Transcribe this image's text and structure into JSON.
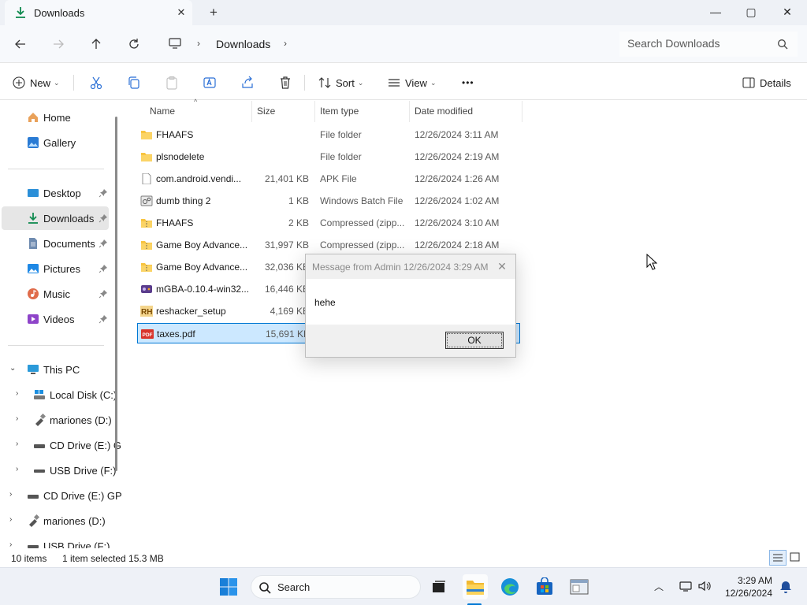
{
  "window": {
    "tab_title": "Downloads",
    "tab_close": "✕",
    "new_tab": "+",
    "minimize": "—",
    "maximize": "▢",
    "close": "✕"
  },
  "address": {
    "crumbs": [
      "Downloads"
    ],
    "search_placeholder": "Search Downloads"
  },
  "commands": {
    "new_label": "New",
    "sort_label": "Sort",
    "view_label": "View",
    "more_label": "•••",
    "details_label": "Details"
  },
  "sidebar": {
    "items": [
      {
        "label": "Home",
        "icon": "home-icon"
      },
      {
        "label": "Gallery",
        "icon": "gallery-icon"
      },
      {
        "label": "Desktop",
        "icon": "desktop-icon",
        "pinned": true
      },
      {
        "label": "Downloads",
        "icon": "download-icon",
        "pinned": true,
        "selected": true
      },
      {
        "label": "Documents",
        "icon": "documents-icon",
        "pinned": true
      },
      {
        "label": "Pictures",
        "icon": "pictures-icon",
        "pinned": true
      },
      {
        "label": "Music",
        "icon": "music-icon",
        "pinned": true
      },
      {
        "label": "Videos",
        "icon": "videos-icon",
        "pinned": true
      },
      {
        "label": "This PC",
        "icon": "pc-icon",
        "expanded": true
      },
      {
        "label": "Local Disk (C:)",
        "icon": "disk-icon"
      },
      {
        "label": "mariones (D:)",
        "icon": "usb-icon"
      },
      {
        "label": "CD Drive (E:) G",
        "icon": "cd-drive-icon"
      },
      {
        "label": "USB Drive (F:)",
        "icon": "usb-drive-icon"
      },
      {
        "label": "CD Drive (E:) GP",
        "icon": "cd-drive-icon"
      },
      {
        "label": "mariones (D:)",
        "icon": "usb-icon"
      },
      {
        "label": "USB Drive (F:)",
        "icon": "usb-drive-icon"
      }
    ]
  },
  "filelist": {
    "columns": [
      "Name",
      "Size",
      "Item type",
      "Date modified"
    ],
    "rows": [
      {
        "name": "FHAAFS",
        "size": "",
        "type": "File folder",
        "date": "12/26/2024 3:11 AM",
        "icon": "folder-icon"
      },
      {
        "name": "plsnodelete",
        "size": "",
        "type": "File folder",
        "date": "12/26/2024 2:19 AM",
        "icon": "folder-icon"
      },
      {
        "name": "com.android.vendi...",
        "size": "21,401 KB",
        "type": "APK File",
        "date": "12/26/2024 1:26 AM",
        "icon": "file-icon"
      },
      {
        "name": "dumb thing 2",
        "size": "1 KB",
        "type": "Windows Batch File",
        "date": "12/26/2024 1:02 AM",
        "icon": "batch-file-icon"
      },
      {
        "name": "FHAAFS",
        "size": "2 KB",
        "type": "Compressed (zipp...",
        "date": "12/26/2024 3:10 AM",
        "icon": "zip-folder-icon"
      },
      {
        "name": "Game Boy Advance...",
        "size": "31,997 KB",
        "type": "Compressed (zipp...",
        "date": "12/26/2024 2:18 AM",
        "icon": "zip-folder-icon"
      },
      {
        "name": "Game Boy Advance...",
        "size": "32,036 KB",
        "type": "",
        "date": "",
        "icon": "zip-folder-icon"
      },
      {
        "name": "mGBA-0.10.4-win32...",
        "size": "16,446 KB",
        "type": "",
        "date": "",
        "icon": "installer-icon"
      },
      {
        "name": "reshacker_setup",
        "size": "4,169 KB",
        "type": "",
        "date": "",
        "icon": "reshacker-icon"
      },
      {
        "name": "taxes.pdf",
        "size": "15,691 KB",
        "type": "",
        "date": "",
        "icon": "pdf-icon",
        "selected": true
      }
    ]
  },
  "status": {
    "items": "10 items",
    "selected": "1 item selected  15.3 MB"
  },
  "dialog": {
    "title": "Message from Admin 12/26/2024 3:29 AM",
    "close": "✕",
    "message": "hehe",
    "ok_label": "OK"
  },
  "taskbar": {
    "search_label": "Search",
    "time": "3:29 AM",
    "date": "12/26/2024"
  },
  "colors": {
    "accent": "#0078d4",
    "selection": "#cce8ff",
    "folder": "#f8c440"
  }
}
